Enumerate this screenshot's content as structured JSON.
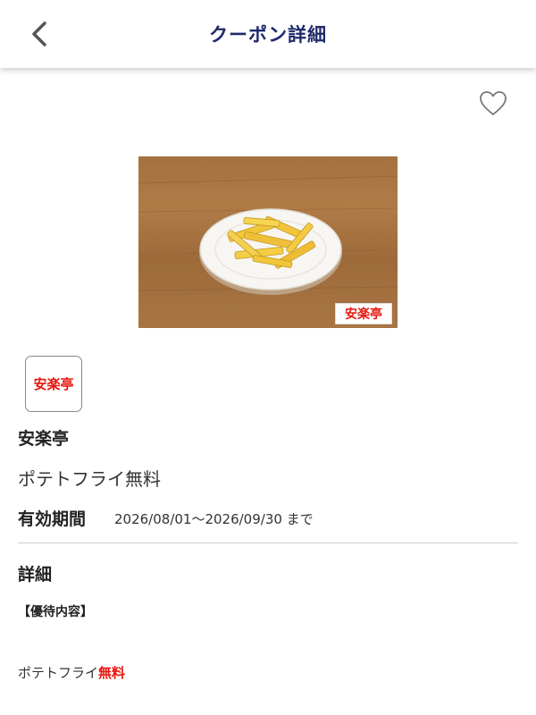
{
  "header": {
    "title": "クーポン詳細",
    "back_icon": "chevron-left-icon"
  },
  "favorite_icon": "heart-outline-icon",
  "hero": {
    "logo_text": "安楽亭"
  },
  "store": {
    "logo_text": "安楽亭",
    "name": "安楽亭"
  },
  "coupon": {
    "name": "ポテトフライ無料",
    "validity_label": "有効期間",
    "validity_value": "2026/08/01〜2026/09/30 まで"
  },
  "details": {
    "heading": "詳細",
    "benefit_label": "【優待内容】",
    "benefit_text": "ポテトフライ",
    "benefit_highlight": "無料"
  },
  "colors": {
    "header_title": "#1f2a6b",
    "brand_red": "#e8170f"
  }
}
